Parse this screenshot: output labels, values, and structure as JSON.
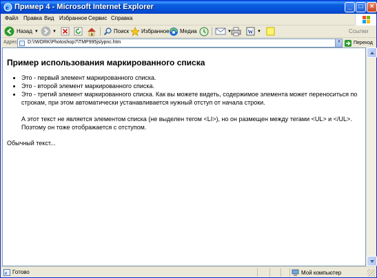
{
  "window": {
    "title": "Пример 4 - Microsoft Internet Explorer",
    "title_bar_color": "#0a5fe0"
  },
  "menu": {
    "items": [
      "Файл",
      "Правка",
      "Вид",
      "Избранное",
      "Сервис",
      "Справка"
    ]
  },
  "toolbar": {
    "back_label": "Назад",
    "search_label": "Поиск",
    "favorites_label": "Избранное",
    "media_label": "Медиа",
    "links_label": "Ссылки"
  },
  "address": {
    "label": "Адрес:",
    "value": "D:\\!WORK\\Photoshop7\\TMP995jslypnc.htm",
    "go_label": "Переход"
  },
  "page": {
    "heading": "Пример использования маркированного списка",
    "list_items": [
      "Это - первый элемент маркированного списка.",
      "Это - второй элемент маркированного списка.",
      "Это - третий элемент маркированного списка. Как вы можете видеть, содержимое элемента может переноситься по строкам, при этом автоматически устанавливается нужный отступ от начала строки."
    ],
    "indented_text": "А этот текст не является элементом списка (не выделен тегом <LI>), но он размещен между тегами <UL> и </UL>. Поэтому он тоже отображается с отступом.",
    "plain_text": "Обычный текст..."
  },
  "status": {
    "text": "Готово",
    "zone": "Мой компьютер"
  }
}
